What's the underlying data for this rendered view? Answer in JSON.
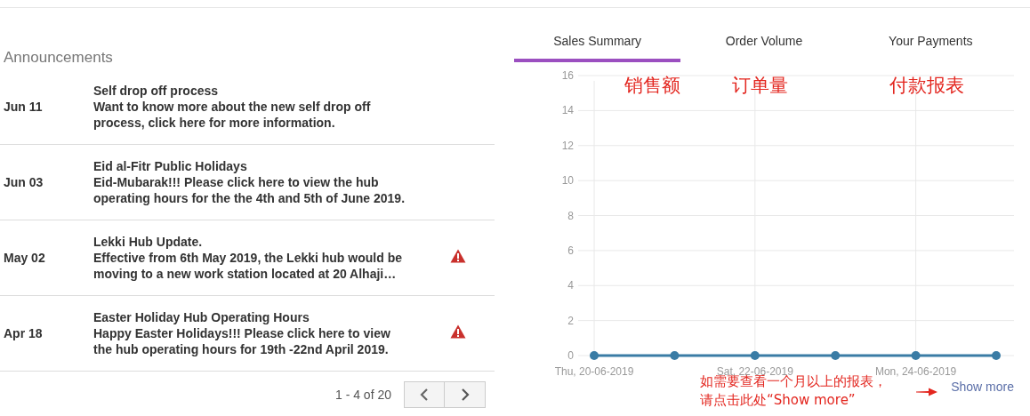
{
  "announcements": {
    "title": "Announcements",
    "items": [
      {
        "date": "Jun 11",
        "title": "Self drop off process",
        "body": "Want to know more about the new self drop off process, click here for more information.",
        "warning": false
      },
      {
        "date": "Jun 03",
        "title": "Eid al-Fitr Public Holidays",
        "body": "Eid-Mubarak!!! Please click here to view the hub operating hours for the the 4th and 5th of June 2019.",
        "warning": false
      },
      {
        "date": "May 02",
        "title": "Lekki Hub Update.",
        "body": "Effective from 6th May 2019, the Lekki hub would be moving to a new work station located at 20 Alhaji…",
        "warning": true
      },
      {
        "date": "Apr 18",
        "title": "Easter Holiday Hub Operating Hours",
        "body": "Happy Easter Holidays!!! Please click here to view the hub operating hours for 19th -22nd April 2019.",
        "warning": true
      }
    ],
    "pagination": {
      "range": "1 - 4 of 20"
    }
  },
  "reports": {
    "tabs": [
      {
        "label": "Sales Summary",
        "selected": true
      },
      {
        "label": "Order Volume",
        "selected": false
      },
      {
        "label": "Your Payments",
        "selected": false
      }
    ],
    "chart_data": {
      "type": "line",
      "categories": [
        "Thu, 20-06-2019",
        null,
        "Sat, 22-06-2019",
        null,
        "Mon, 24-06-2019",
        null
      ],
      "series": [
        {
          "color": "#3a7ca5",
          "marker": "circle",
          "values": [
            0,
            0,
            0,
            0,
            0,
            0
          ]
        }
      ],
      "grid": true,
      "ylim": [
        0,
        16
      ],
      "yticks": [
        0,
        2,
        4,
        6,
        8,
        10,
        12,
        14,
        16
      ]
    },
    "show_more": "Show more",
    "callouts": {
      "tab_notes": [
        "销售额",
        "订单量",
        "付款报表"
      ],
      "footer_note": [
        "如需要查看一个月以上的报表，",
        "请点击此处“Show more”"
      ]
    }
  }
}
